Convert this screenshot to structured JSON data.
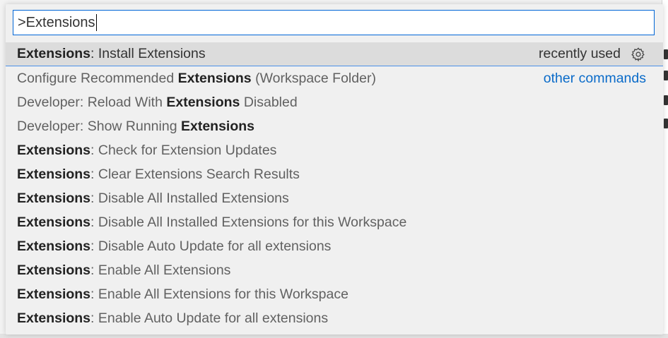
{
  "quick_input": {
    "value": ">Extensions",
    "highlight_color": "#0066d6"
  },
  "items": [
    {
      "pre": "",
      "hl": "Extensions",
      "post": ": Install Extensions",
      "right": "recently used",
      "gear": true,
      "focused": true
    },
    {
      "pre": "Configure Recommended ",
      "hl": "Extensions",
      "post": " (Workspace Folder)",
      "right": "other commands",
      "rightStyle": "link"
    },
    {
      "pre": "Developer: Reload With ",
      "hl": "Extensions",
      "post": " Disabled"
    },
    {
      "pre": "Developer: Show Running ",
      "hl": "Extensions",
      "post": ""
    },
    {
      "pre": "",
      "hl": "Extensions",
      "post": ": Check for Extension Updates"
    },
    {
      "pre": "",
      "hl": "Extensions",
      "post": ": Clear Extensions Search Results"
    },
    {
      "pre": "",
      "hl": "Extensions",
      "post": ": Disable All Installed Extensions"
    },
    {
      "pre": "",
      "hl": "Extensions",
      "post": ": Disable All Installed Extensions for this Workspace"
    },
    {
      "pre": "",
      "hl": "Extensions",
      "post": ": Disable Auto Update for all extensions"
    },
    {
      "pre": "",
      "hl": "Extensions",
      "post": ": Enable All Extensions"
    },
    {
      "pre": "",
      "hl": "Extensions",
      "post": ": Enable All Extensions for this Workspace"
    },
    {
      "pre": "",
      "hl": "Extensions",
      "post": ": Enable Auto Update for all extensions"
    }
  ],
  "icons": {
    "gear": "gear-icon"
  }
}
